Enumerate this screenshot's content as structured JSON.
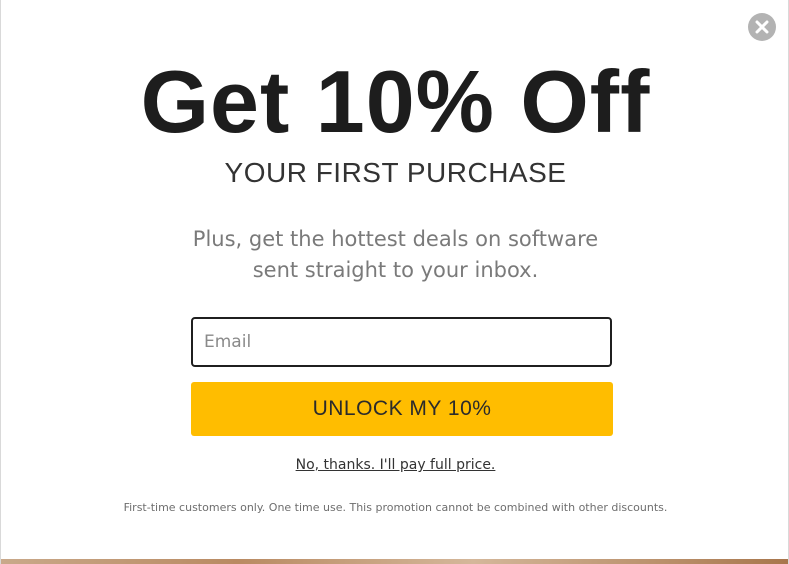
{
  "modal": {
    "close_icon": "close-x-icon",
    "headline": "Get 10% Off",
    "subheadline": "YOUR FIRST PURCHASE",
    "body_line_1": "Plus, get the hottest deals on software",
    "body_line_2": "sent straight to your inbox.",
    "email": {
      "placeholder": "Email",
      "value": ""
    },
    "unlock_button_label": "UNLOCK MY 10%",
    "decline_link_label": "No, thanks. I'll pay full price.",
    "disclaimer": "First-time customers only. One time use. This promotion cannot be combined with other discounts."
  },
  "colors": {
    "accent": "#ffbd00",
    "headline": "#1d1d1d",
    "close_button": "#b3b3b3"
  }
}
